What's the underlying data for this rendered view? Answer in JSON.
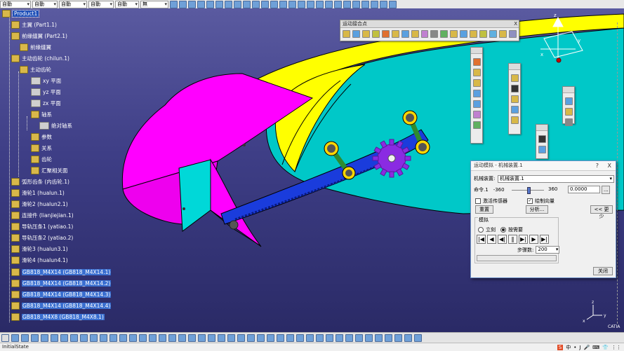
{
  "toolbar_top": {
    "combos": [
      "自動",
      "自動",
      "自動",
      "自動",
      "自動",
      "無"
    ]
  },
  "tree": {
    "nodes": [
      {
        "label": "Product1"
      },
      {
        "label": "主翼 (Part1.1)"
      },
      {
        "label": "前缘缝翼 (Part2.1)"
      },
      {
        "label": "前缘缝翼"
      },
      {
        "label": "主动齿轮 (chilun.1)"
      },
      {
        "label": "主动齿轮"
      },
      {
        "label": "xy 平面"
      },
      {
        "label": "yz 平面"
      },
      {
        "label": "zx 平面"
      },
      {
        "label": "轴系"
      },
      {
        "label": "绝对轴系"
      },
      {
        "label": "参数"
      },
      {
        "label": "关系"
      },
      {
        "label": "齿轮"
      },
      {
        "label": "汇聚相关面"
      },
      {
        "label": "弧形齿条 (内齿轮.1)"
      },
      {
        "label": "滑轮1 (hualun.1)"
      },
      {
        "label": "滑轮2 (hualun2.1)"
      },
      {
        "label": "连接件 (lianjiejian.1)"
      },
      {
        "label": "导轨压条1 (yatiao.1)"
      },
      {
        "label": "导轨压条2 (yatiao.2)"
      },
      {
        "label": "滑轮3 (hualun3.1)"
      },
      {
        "label": "滑轮4 (hualun4.1)"
      },
      {
        "label": "GB818_M4X14 (GB818_M4X14.1)"
      },
      {
        "label": "GB818_M4X14 (GB818_M4X14.2)"
      },
      {
        "label": "GB818_M4X14 (GB818_M4X14.3)"
      },
      {
        "label": "GB818_M4X14 (GB818_M4X14.4)"
      },
      {
        "label": "GB818_M4X8 (GB818_M4X8.1)"
      }
    ]
  },
  "toolbar_panel": {
    "title": "运动接合点",
    "close": "X"
  },
  "dialog": {
    "title": "运动模拟 - 机械装置.1",
    "help": "?",
    "close": "X",
    "mechanism_label": "机械装置:",
    "mechanism_value": "机械装置.1",
    "command_label": "命令.1",
    "range_min": "-360",
    "range_max": "360",
    "command_value": "0.0000",
    "more_btn": "...",
    "activate_sensors": "激活传感器",
    "activate_sensors_checked": false,
    "draw_vectors": "绘制向量",
    "draw_vectors_checked": true,
    "reset_btn": "重置",
    "analysis_btn": "分析...",
    "less_btn": "<< 更少",
    "simulation_group": "模拟",
    "immediate": "立刻",
    "on_request": "按需要",
    "on_request_selected": true,
    "steps_label": "步骤数:",
    "steps_value": "200",
    "close_btn": "关闭",
    "player_buttons": [
      "|◀",
      "◀",
      "◀|",
      "‖",
      "▶|",
      "▶",
      "▶|"
    ]
  },
  "compass": {
    "x": "x",
    "y": "y",
    "z": "z"
  },
  "axis_small": {
    "x": "x",
    "y": "y",
    "z": "z"
  },
  "brand": "CATIA",
  "status": {
    "text": "InitialState"
  },
  "ime": {
    "items": [
      "S",
      "中",
      "•",
      "J",
      "🎤",
      "⌨",
      "👕",
      "⋮⋮"
    ]
  },
  "colors": {
    "background_top": "#5a5aa0",
    "main_wing": "#00c8c8",
    "slat": "#ffff00",
    "slat_tip": "#ff00ff",
    "rack": "#1a3cdc",
    "gear": "#8a2be2",
    "roller_link": "#2e8b2e"
  }
}
